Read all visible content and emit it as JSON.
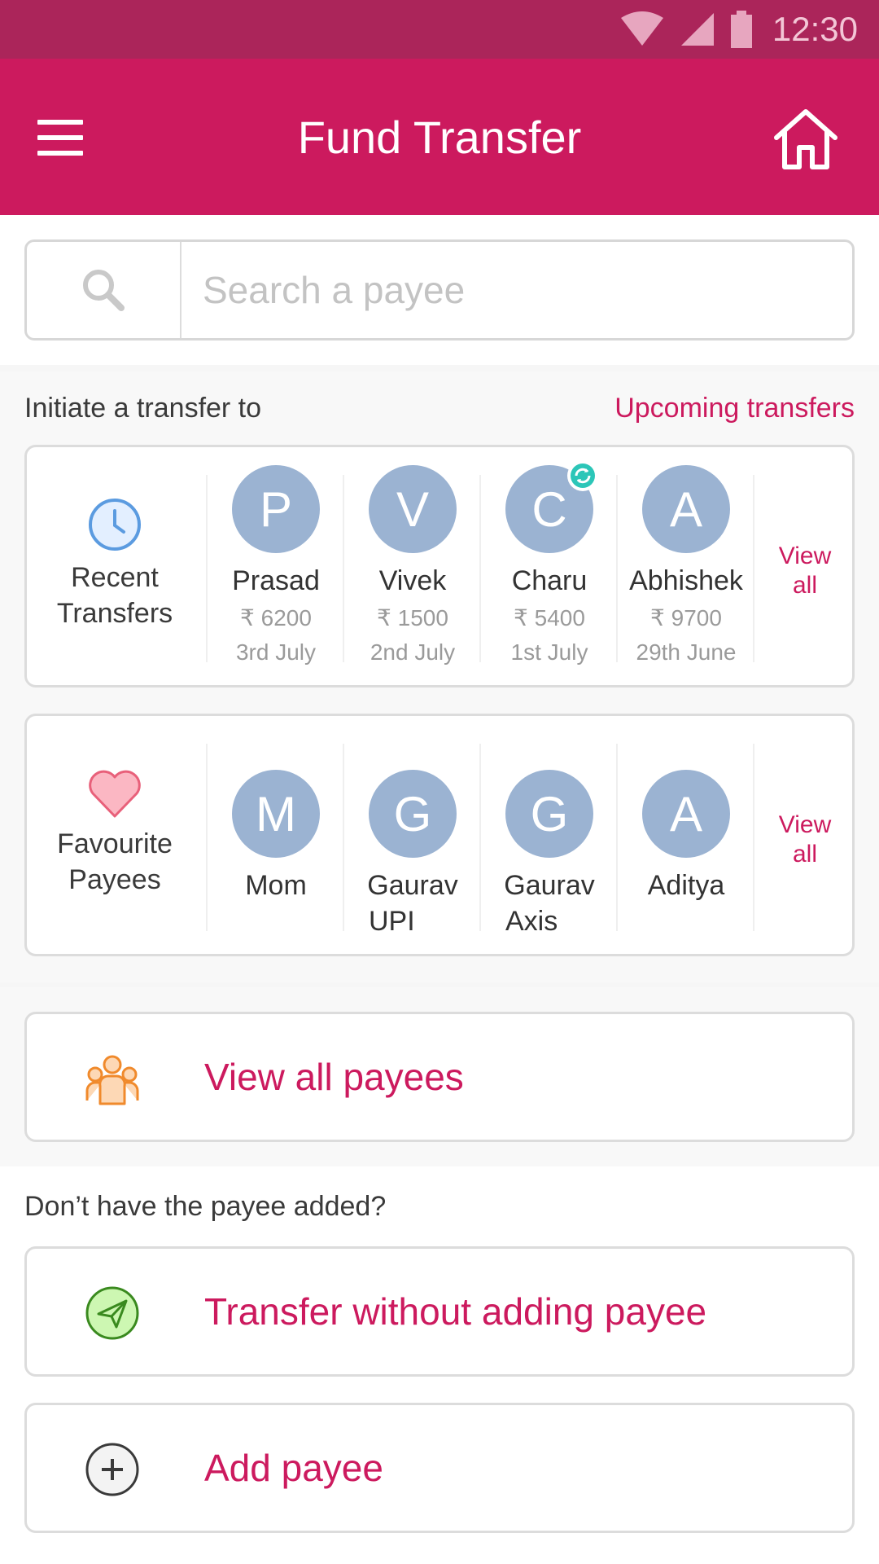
{
  "status_bar": {
    "time": "12:30"
  },
  "app_bar": {
    "title": "Fund Transfer"
  },
  "search": {
    "placeholder": "Search a payee"
  },
  "initiate": {
    "heading": "Initiate a transfer to",
    "upcoming_link": "Upcoming transfers",
    "recent": {
      "label_line1": "Recent",
      "label_line2": "Transfers",
      "items": [
        {
          "initial": "P",
          "name": "Prasad",
          "amount": "₹ 6200",
          "date": "3rd July"
        },
        {
          "initial": "V",
          "name": "Vivek",
          "amount": "₹ 1500",
          "date": "2nd July"
        },
        {
          "initial": "C",
          "name": "Charu",
          "amount": "₹ 5400",
          "date": "1st July"
        },
        {
          "initial": "A",
          "name": "Abhishek",
          "amount": "₹ 9700",
          "date": "29th June"
        }
      ],
      "view_all_line1": "View",
      "view_all_line2": "all"
    },
    "favourites": {
      "label_line1": "Favourite",
      "label_line2": "Payees",
      "items": [
        {
          "initial": "M",
          "name_line1": "Mom",
          "name_line2": ""
        },
        {
          "initial": "G",
          "name_line1": "Gaurav",
          "name_line2": "UPI"
        },
        {
          "initial": "G",
          "name_line1": "Gaurav",
          "name_line2": "Axis"
        },
        {
          "initial": "A",
          "name_line1": "Aditya",
          "name_line2": ""
        }
      ],
      "view_all_line1": "View",
      "view_all_line2": "all"
    }
  },
  "actions": {
    "view_all_payees": "View all payees",
    "dont_have_heading": "Don’t have the payee added?",
    "transfer_without_adding": "Transfer without adding  payee",
    "add_payee": "Add  payee"
  },
  "colors": {
    "status_bar": "#ab255a",
    "app_bar": "#cc1a5e",
    "accent": "#cc1a5e",
    "avatar": "#9bb3d2"
  }
}
